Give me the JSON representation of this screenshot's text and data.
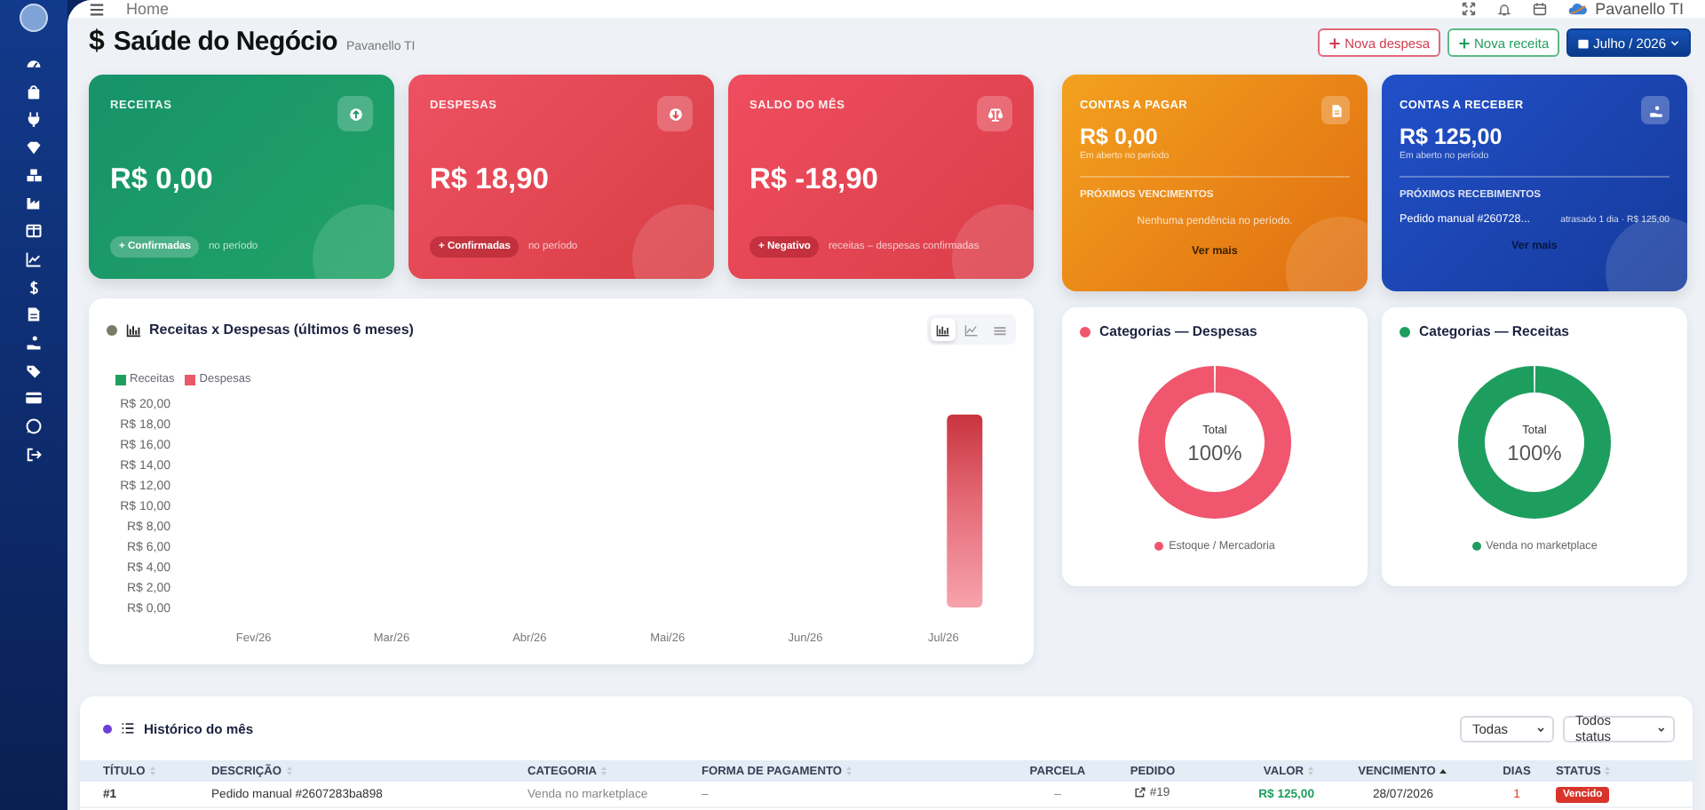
{
  "topbar": {
    "breadcrumb": "Home",
    "user": "Pavanello TI"
  },
  "header": {
    "icon": "$",
    "title": "Saúde do Negócio",
    "subtitle": "Pavanello TI",
    "buttons": [
      {
        "kind": "expense",
        "label": "Nova despesa"
      },
      {
        "kind": "income",
        "label": "Nova receita"
      },
      {
        "kind": "period",
        "label": "Julho / 2026"
      }
    ]
  },
  "cards": [
    {
      "kind": "income",
      "label": "RECEITAS",
      "value": "R$ 0,00",
      "badge": "+ Confirmadas",
      "note": "no período"
    },
    {
      "kind": "expense",
      "label": "DESPESAS",
      "value": "R$ 18,90",
      "badge": "+ Confirmadas",
      "note": "no período"
    },
    {
      "kind": "balance",
      "label": "SALDO DO MÊS",
      "value": "R$ -18,90",
      "badge": "+ Negativo",
      "note": "receitas – despesas confirmadas"
    }
  ],
  "accounts": [
    {
      "kind": "payable",
      "label": "CONTAS A PAGAR",
      "value": "R$ 0,00",
      "subtitle": "Em aberto no período",
      "section": "PRÓXIMOS VENCIMENTOS",
      "empty_note": "Nenhuma pendência no período.",
      "link": "Ver mais"
    },
    {
      "kind": "receivable",
      "label": "CONTAS A RECEBER",
      "value": "R$ 125,00",
      "subtitle": "Em aberto no período",
      "section": "PRÓXIMOS RECEBIMENTOS",
      "entries": [
        {
          "name": "Pedido manual #260728...",
          "detail": "atrasado 1 dia · R$ 125,00"
        }
      ],
      "link": "Ver mais"
    }
  ],
  "trend": {
    "title": "Receitas x Despesas (últimos 6 meses)",
    "view_buttons": [
      {
        "selected": true
      },
      {
        "selected": false
      },
      {
        "selected": false
      }
    ],
    "legend": [
      {
        "name": "Receitas",
        "color": "#1e9e5e"
      },
      {
        "name": "Despesas",
        "color": "#e8596a"
      }
    ],
    "y_labels": [
      "R$ 20,00",
      "R$ 18,00",
      "R$ 16,00",
      "R$ 14,00",
      "R$ 12,00",
      "R$ 10,00",
      "R$ 8,00",
      "R$ 6,00",
      "R$ 4,00",
      "R$ 2,00",
      "R$ 0,00"
    ],
    "months": [
      {
        "label": "Fev/26"
      },
      {
        "label": "Mar/26"
      },
      {
        "label": "Abr/26"
      },
      {
        "label": "Mai/26"
      },
      {
        "label": "Jun/26"
      },
      {
        "label": "Jul/26",
        "expense_bar": {
          "level": 0.945
        }
      }
    ]
  },
  "categories": [
    {
      "title": "Categorias — Despesas",
      "color": "#f0566e",
      "center_label": "Total",
      "center_value": "100%",
      "legend": "Estoque / Mercadoria"
    },
    {
      "title": "Categorias — Receitas",
      "color": "#1e9e5e",
      "center_label": "Total",
      "center_value": "100%",
      "legend": "Venda no marketplace"
    }
  ],
  "history": {
    "title": "Histórico do mês",
    "filters": [
      {
        "value": "Todas"
      },
      {
        "value": "Todos status"
      }
    ],
    "columns": [
      {
        "label": "TÍTULO",
        "sortable": true,
        "sorted": false
      },
      {
        "label": "DESCRIÇÃO",
        "sortable": true,
        "sorted": false
      },
      {
        "label": "CATEGORIA",
        "sortable": true,
        "sorted": false
      },
      {
        "label": "FORMA DE PAGAMENTO",
        "sortable": true,
        "sorted": false
      },
      {
        "label": "PARCELA",
        "sortable": false,
        "sorted": false
      },
      {
        "label": "PEDIDO",
        "sortable": false,
        "sorted": false
      },
      {
        "label": "VALOR",
        "sortable": true,
        "sorted": false
      },
      {
        "label": "VENCIMENTO",
        "sortable": true,
        "sorted": true
      },
      {
        "label": "DIAS",
        "sortable": false,
        "sorted": false
      },
      {
        "label": "STATUS",
        "sortable": true,
        "sorted": false
      }
    ],
    "rows": [
      {
        "title": "#1",
        "description": "Pedido manual #2607283ba898",
        "category": "Venda no marketplace",
        "payment": "–",
        "installment": "–",
        "order": "#19",
        "amount": "R$ 125,00",
        "due": "28/07/2026",
        "days": "1",
        "status": "Vencido"
      }
    ]
  }
}
